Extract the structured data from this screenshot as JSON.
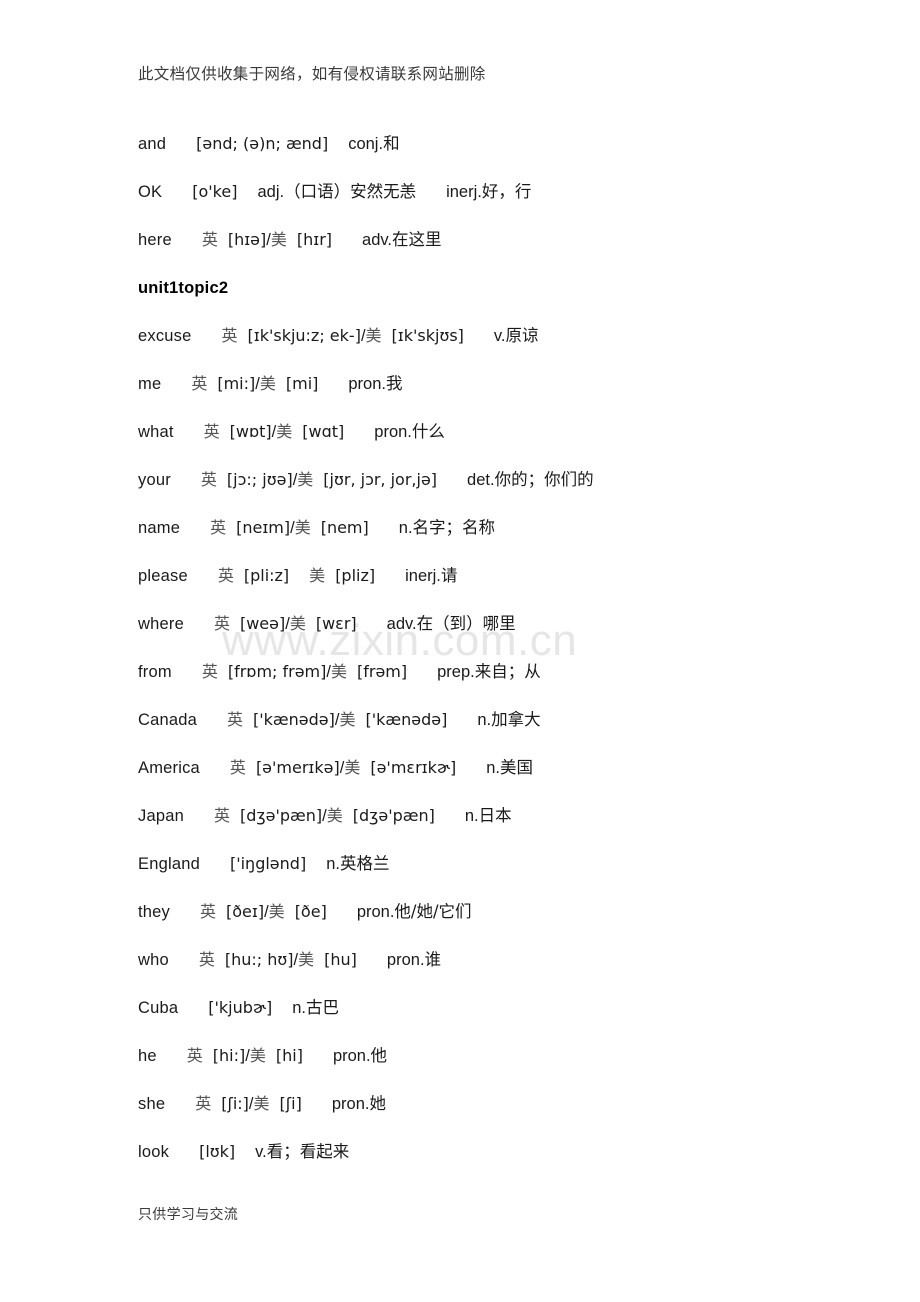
{
  "header": {
    "notice": "此文档仅供收集于网络，如有侵权请联系网站删除"
  },
  "watermark": {
    "text": "www.zixin.com.cn",
    "color": "#e6e6e6"
  },
  "footer": {
    "notice": "只供学习与交流"
  },
  "labels": {
    "uk": "英",
    "us": "美",
    "separator": "/"
  },
  "entries": [
    {
      "word": "and",
      "uk_label": "",
      "uk_ipa": "[ənd; (ə)n; ænd]",
      "separator": "",
      "us_label": "",
      "us_ipa": "",
      "pos": "conj.",
      "meaning": "和"
    },
    {
      "word": "OK",
      "uk_label": "",
      "uk_ipa": "[o'ke]",
      "separator": "",
      "us_label": "",
      "us_ipa": "",
      "pos": "adj.",
      "meaning": "（口语）安然无恙",
      "pos2": "inerj.",
      "meaning2": "好，行"
    },
    {
      "word": "here",
      "uk_label": "英",
      "uk_ipa": "[hɪə]",
      "separator": "/",
      "us_label": "美",
      "us_ipa": "[hɪr]",
      "pos": "adv.",
      "meaning": "在这里"
    }
  ],
  "section": {
    "title": "unit1topic2"
  },
  "entries2": [
    {
      "word": "excuse",
      "uk_label": "英",
      "uk_ipa": "[ɪk'skju:z; ek-]",
      "separator": "/",
      "us_label": "美",
      "us_ipa": "[ɪk'skjʊs]",
      "pos": "v.",
      "meaning": "原谅"
    },
    {
      "word": "me",
      "uk_label": "英",
      "uk_ipa": "[mi:]",
      "separator": "/",
      "us_label": "美",
      "us_ipa": "[mi]",
      "pos": "pron.",
      "meaning": "我"
    },
    {
      "word": "what",
      "uk_label": "英",
      "uk_ipa": "[wɒt]",
      "separator": "/",
      "us_label": "美",
      "us_ipa": "[wɑt]",
      "pos": "pron.",
      "meaning": "什么"
    },
    {
      "word": "your",
      "uk_label": "英",
      "uk_ipa": "[jɔ:; jʊə]",
      "separator": "/",
      "us_label": "美",
      "us_ipa": "[jʊr, jɔr, jor,jə]",
      "pos": "det.",
      "meaning": "你的；你们的"
    },
    {
      "word": "name",
      "uk_label": "英",
      "uk_ipa": "[neɪm]",
      "separator": "/",
      "us_label": "美",
      "us_ipa": "[nem]",
      "pos": "n.",
      "meaning": "名字；名称"
    },
    {
      "word": "please",
      "uk_label": "英",
      "uk_ipa": "[pli:z]",
      "separator": "",
      "us_label": "美",
      "us_ipa": "[pliz]",
      "pos": "inerj.",
      "meaning": "请"
    },
    {
      "word": "where",
      "uk_label": "英",
      "uk_ipa": "[weə]",
      "separator": "/",
      "us_label": "美",
      "us_ipa": "[wɛr]",
      "pos": "adv.",
      "meaning": "在（到）哪里"
    },
    {
      "word": "from",
      "uk_label": "英",
      "uk_ipa": "[frɒm; frəm]",
      "separator": "/",
      "us_label": "美",
      "us_ipa": "[frəm]",
      "pos": "prep.",
      "meaning": "来自；从"
    },
    {
      "word": "Canada",
      "uk_label": "英",
      "uk_ipa": "['kænədə]",
      "separator": "/",
      "us_label": "美",
      "us_ipa": "['kænədə]",
      "pos": "n.",
      "meaning": "加拿大"
    },
    {
      "word": "America",
      "uk_label": "英",
      "uk_ipa": "[ə'merɪkə]",
      "separator": "/",
      "us_label": "美",
      "us_ipa": "[ə'mɛrɪkɚ]",
      "pos": "n.",
      "meaning": "美国"
    },
    {
      "word": "Japan",
      "uk_label": "英",
      "uk_ipa": "[dʒə'pæn]",
      "separator": "/",
      "us_label": "美",
      "us_ipa": "[dʒə'pæn]",
      "pos": "n.",
      "meaning": "日本"
    },
    {
      "word": "England",
      "uk_label": "",
      "uk_ipa": "['iŋglənd]",
      "separator": "",
      "us_label": "",
      "us_ipa": "",
      "pos": "n.",
      "meaning": "英格兰"
    },
    {
      "word": "they",
      "uk_label": "英",
      "uk_ipa": "[ðeɪ]",
      "separator": "/",
      "us_label": "美",
      "us_ipa": "[ðe]",
      "pos": "pron.",
      "meaning": "他/她/它们"
    },
    {
      "word": "who",
      "uk_label": "英",
      "uk_ipa": "[hu:; hʊ]",
      "separator": "/",
      "us_label": "美",
      "us_ipa": "[hu]",
      "pos": "pron.",
      "meaning": "谁"
    },
    {
      "word": "Cuba",
      "uk_label": "",
      "uk_ipa": "['kjubɚ]",
      "separator": "",
      "us_label": "",
      "us_ipa": "",
      "pos": "n.",
      "meaning": "古巴"
    },
    {
      "word": "he",
      "uk_label": "英",
      "uk_ipa": "[hi:]",
      "separator": "/",
      "us_label": "美",
      "us_ipa": "[hi]",
      "pos": "pron.",
      "meaning": "他"
    },
    {
      "word": "she",
      "uk_label": "英",
      "uk_ipa": "[ʃi:]",
      "separator": "/",
      "us_label": "美",
      "us_ipa": "[ʃi]",
      "pos": "pron.",
      "meaning": "她"
    },
    {
      "word": "look",
      "uk_label": "",
      "uk_ipa": "[lʊk]",
      "separator": "",
      "us_label": "",
      "us_ipa": "",
      "pos": "v.",
      "meaning": "看；看起来"
    }
  ]
}
